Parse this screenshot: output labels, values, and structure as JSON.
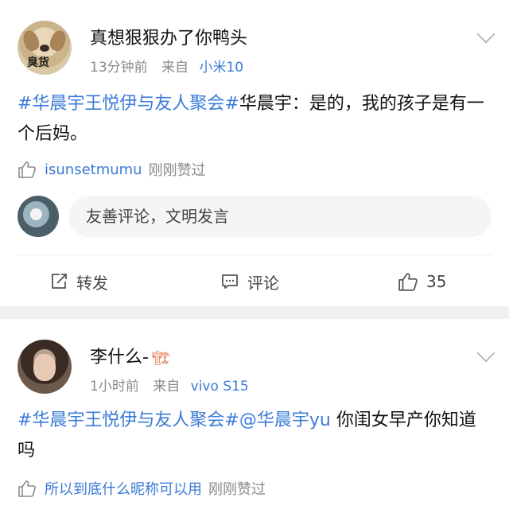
{
  "post1": {
    "username": "真想狠狠办了你鸭头",
    "avatar_caption": "臭货",
    "time": "13分钟前",
    "from_label": "来自",
    "device": "小米10",
    "hashtag": "#华晨宇王悦伊与友人聚会#",
    "text": "华晨宇：是的，我的孩子是有一个后妈。",
    "liked_user": "isunsetmumu",
    "liked_suffix": "刚刚赞过",
    "comment_placeholder": "友善评论，文明发言",
    "action_repost": "转发",
    "action_comment": "评论",
    "like_count": "35"
  },
  "post2": {
    "username": "李什么-",
    "username_emoji": "🏗",
    "time": "1小时前",
    "from_label": "来自",
    "device": "vivo S15",
    "hashtag": "#华晨宇王悦伊与友人聚会#",
    "mention": "@华晨宇yu",
    "text": " 你闺女早产你知道吗",
    "liked_user": "所以到底什么昵称可以用",
    "liked_suffix": "刚刚赞过"
  },
  "colors": {
    "link": "#3b7bd8",
    "meta": "#8a8a8a",
    "separator": "#f1f1f1"
  }
}
